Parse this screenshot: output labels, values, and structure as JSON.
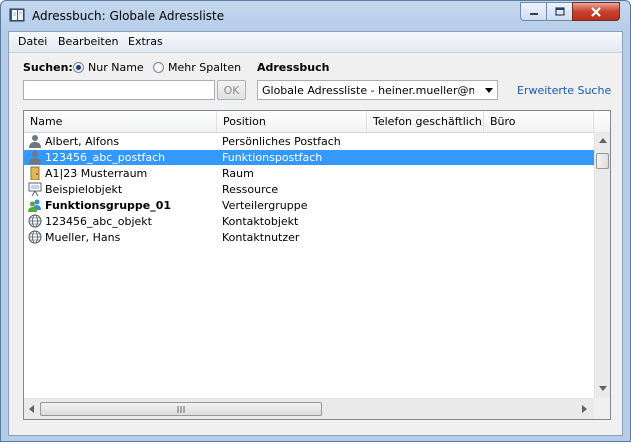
{
  "window": {
    "title": "Adressbuch: Globale Adressliste"
  },
  "menu": {
    "items": [
      "Datei",
      "Bearbeiten",
      "Extras"
    ]
  },
  "search": {
    "label": "Suchen:",
    "option_name": "Nur Name",
    "option_columns": "Mehr Spalten",
    "selected": "Nur Name",
    "input_value": "",
    "ok_label": "OK"
  },
  "addressbook": {
    "label": "Adressbuch",
    "selected": "Globale Adressliste - heiner.mueller@m..",
    "advanced_search": "Erweiterte Suche"
  },
  "table": {
    "columns": [
      "Name",
      "Position",
      "Telefon geschäftlich",
      "Büro"
    ],
    "rows": [
      {
        "icon": "user-icon",
        "name": "Albert, Alfons",
        "position": "Persönliches Postfach",
        "bold": false,
        "selected": false
      },
      {
        "icon": "user-icon",
        "name": "123456_abc_postfach",
        "position": "Funktionspostfach",
        "bold": false,
        "selected": true
      },
      {
        "icon": "room-icon",
        "name": "A1|23 Musterraum",
        "position": "Raum",
        "bold": false,
        "selected": false
      },
      {
        "icon": "resource-icon",
        "name": "Beispielobjekt",
        "position": "Ressource",
        "bold": false,
        "selected": false
      },
      {
        "icon": "group-icon",
        "name": "Funktionsgruppe_01",
        "position": "Verteilergruppe",
        "bold": true,
        "selected": false
      },
      {
        "icon": "globe-icon",
        "name": "123456_abc_objekt",
        "position": "Kontaktobjekt",
        "bold": false,
        "selected": false
      },
      {
        "icon": "globe-icon",
        "name": "Mueller, Hans",
        "position": "Kontaktnutzer",
        "bold": false,
        "selected": false
      }
    ]
  },
  "colors": {
    "selection": "#3399ff",
    "link": "#1a57b8",
    "close_button": "#c7422d"
  }
}
